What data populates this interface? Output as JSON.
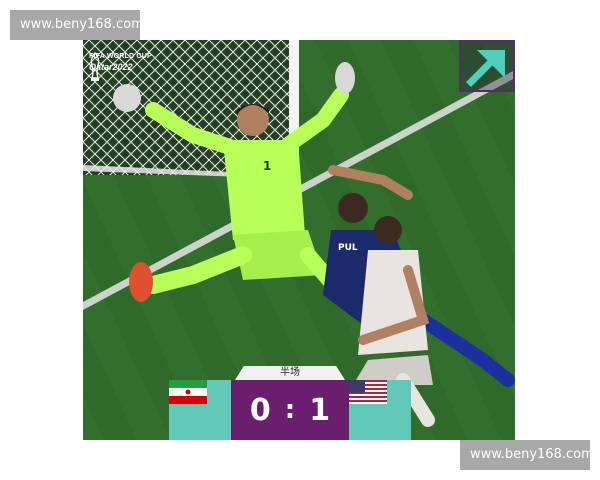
{
  "watermarks": {
    "top": "www.beny168.com",
    "bottom": "www.beny168.com"
  },
  "broadcast": {
    "logo_line1": "FIFA WORLD CUP",
    "logo_line2": "Qatar2022"
  },
  "players": {
    "goalkeeper_number": "1",
    "shirt_name_partial": "PUL"
  },
  "scoreboard": {
    "period_label": "半场",
    "home_team_flag": "iran-flag",
    "away_team_flag": "usa-flag",
    "home_score": "0",
    "separator": ":",
    "away_score": "1"
  },
  "colors": {
    "scoreboard_team_bg": "#62c8b8",
    "scoreboard_score_bg": "#6a1f6e",
    "arrow_accent": "#4fd0bd",
    "goalkeeper_kit": "#b9ff5a",
    "pitch": "#2f6a2a"
  },
  "icons": {
    "corner_arrow": "arrow-up-right-icon",
    "trophy": "world-cup-trophy-icon"
  }
}
